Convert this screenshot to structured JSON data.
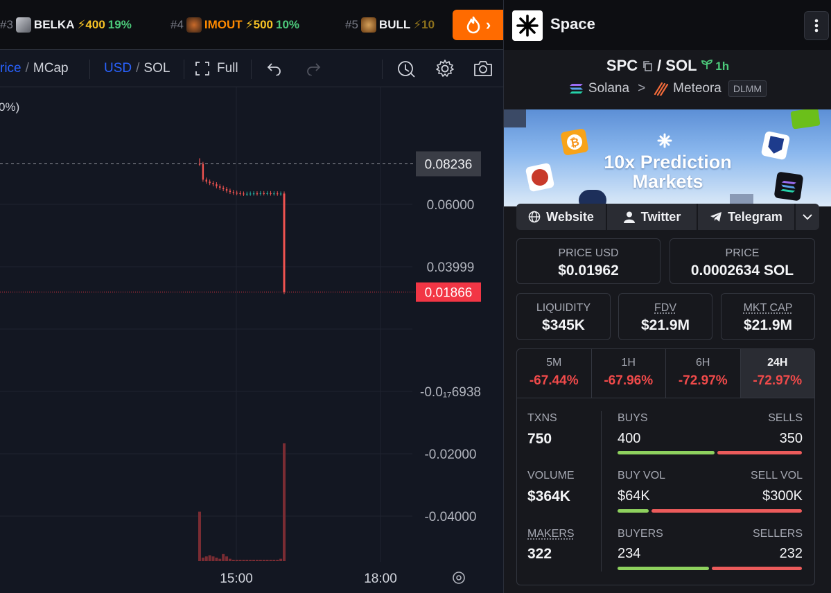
{
  "ticker": {
    "items": [
      {
        "rank": "#3",
        "symbol": "BELKA",
        "boost": "⚡400",
        "change": "19%"
      },
      {
        "rank": "#4",
        "symbol": "IMOUT",
        "boost": "⚡500",
        "change": "10%"
      },
      {
        "rank": "#5",
        "symbol": "BULL",
        "boost": "⚡10",
        "change": ""
      }
    ],
    "hot_arrow": "›"
  },
  "toolbar": {
    "price_label": "rice",
    "mcap_label": "MCap",
    "usd_label": "USD",
    "sol_label": "SOL",
    "full_label": "Full",
    "slash": "/"
  },
  "chart": {
    "legend_fragment": "0%)",
    "price_axis": [
      "0.06000",
      "0.03999",
      "-0.0₁₇6938",
      "-0.02000",
      "-0.04000"
    ],
    "top_price": "0.08236",
    "current_price": "0.01866",
    "time_axis": [
      "15:00",
      "18:00"
    ],
    "colors": {
      "up": "#26a69a",
      "down": "#ef5350",
      "current": "#f23645",
      "top_tag": "#3a3d46"
    }
  },
  "chart_data": {
    "type": "bar",
    "title": "",
    "xlabel": "",
    "ylabel": "",
    "x_ticks": [
      "15:00",
      "18:00"
    ],
    "y_ticks": [
      "0.06000",
      "0.03999",
      "-0.0₁₇6938",
      "-0.02000",
      "-0.04000"
    ],
    "ylim": [
      -0.05,
      0.09
    ],
    "price_markers": {
      "high": 0.08236,
      "last": 0.01866
    },
    "candles_close": [
      0.0823,
      0.0745,
      0.0735,
      0.0728,
      0.0722,
      0.0712,
      0.0705,
      0.0698,
      0.069,
      0.0684,
      0.068,
      0.0678,
      0.0676,
      0.0674,
      0.0675,
      0.0676,
      0.0677,
      0.0676,
      0.0678,
      0.0677,
      0.0678,
      0.0676,
      0.0677,
      0.0675,
      0.0676,
      0.0187
    ],
    "volume_relative": [
      0.42,
      0.03,
      0.04,
      0.05,
      0.04,
      0.03,
      0.02,
      0.06,
      0.04,
      0.02,
      0.01,
      0.01,
      0.01,
      0.01,
      0.01,
      0.01,
      0.01,
      0.01,
      0.01,
      0.01,
      0.01,
      0.01,
      0.01,
      0.01,
      0.02,
      1.0
    ],
    "grid": true
  },
  "panel": {
    "token_name": "Space",
    "pair": {
      "base": "SPC",
      "slash": "/",
      "quote": "SOL",
      "age": "1h"
    },
    "chain": {
      "network": "Solana",
      "separator": ">",
      "dex": "Meteora",
      "pool_type": "DLMM"
    },
    "banner": {
      "line1": "10x Prediction",
      "line2": "Markets"
    },
    "links": {
      "website": "Website",
      "twitter": "Twitter",
      "telegram": "Telegram"
    },
    "price_usd": {
      "label": "PRICE USD",
      "value": "$0.01962"
    },
    "price_sol": {
      "label": "PRICE",
      "value": "0.0002634 SOL"
    },
    "liquidity": {
      "label": "LIQUIDITY",
      "value": "$345K"
    },
    "fdv": {
      "label": "FDV",
      "value": "$21.9M"
    },
    "mkt_cap": {
      "label": "MKT CAP",
      "value": "$21.9M"
    },
    "periods": [
      {
        "label": "5M",
        "value": "-67.44%"
      },
      {
        "label": "1H",
        "value": "-67.96%"
      },
      {
        "label": "6H",
        "value": "-72.97%"
      },
      {
        "label": "24H",
        "value": "-72.97%"
      }
    ],
    "stats": {
      "txns": {
        "label": "TXNS",
        "value": "750"
      },
      "volume": {
        "label": "VOLUME",
        "value": "$364K"
      },
      "makers": {
        "label": "MAKERS",
        "value": "322"
      },
      "buys": {
        "label": "BUYS",
        "value": "400",
        "ratio": 0.533
      },
      "sells": {
        "label": "SELLS",
        "value": "350"
      },
      "buy_vol": {
        "label": "BUY VOL",
        "value": "$64K",
        "ratio": 0.176
      },
      "sell_vol": {
        "label": "SELL VOL",
        "value": "$300K"
      },
      "buyers": {
        "label": "BUYERS",
        "value": "234",
        "ratio": 0.502
      },
      "sellers": {
        "label": "SELLERS",
        "value": "232"
      }
    }
  }
}
